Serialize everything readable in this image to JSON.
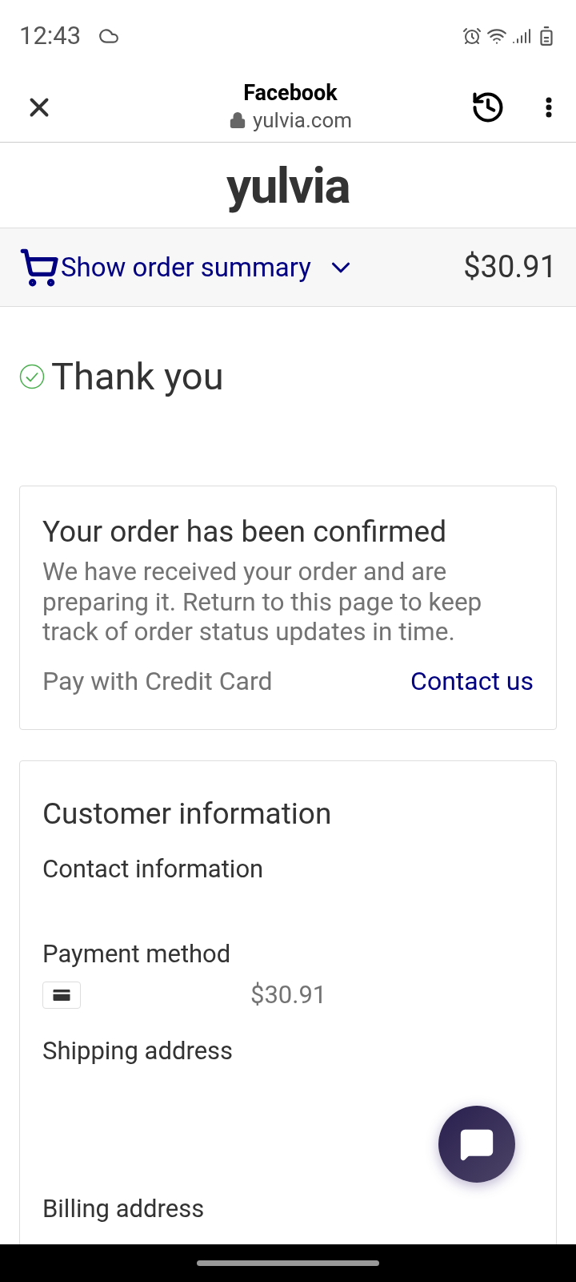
{
  "status_bar": {
    "time": "12:43"
  },
  "browser": {
    "title": "Facebook",
    "url": "yulvia.com"
  },
  "store": {
    "logo": "yulvia"
  },
  "summary_bar": {
    "label": "Show order summary",
    "total": "$30.91",
    "expanded": false
  },
  "heading": {
    "text": "Thank you"
  },
  "confirmation": {
    "title": "Your order has been confirmed",
    "body": "We have received your order and are preparing it. Return to this page to keep track of order status updates in time.",
    "payment": "Pay with Credit Card",
    "contact_link": "Contact us"
  },
  "customer_info": {
    "title": "Customer information",
    "sections": [
      {
        "kind": "label",
        "label": "Contact information"
      },
      {
        "kind": "payment",
        "label": "Payment method",
        "amount": "$30.91"
      },
      {
        "kind": "label",
        "label": "Shipping address"
      },
      {
        "kind": "label",
        "label": "Billing address"
      }
    ]
  }
}
